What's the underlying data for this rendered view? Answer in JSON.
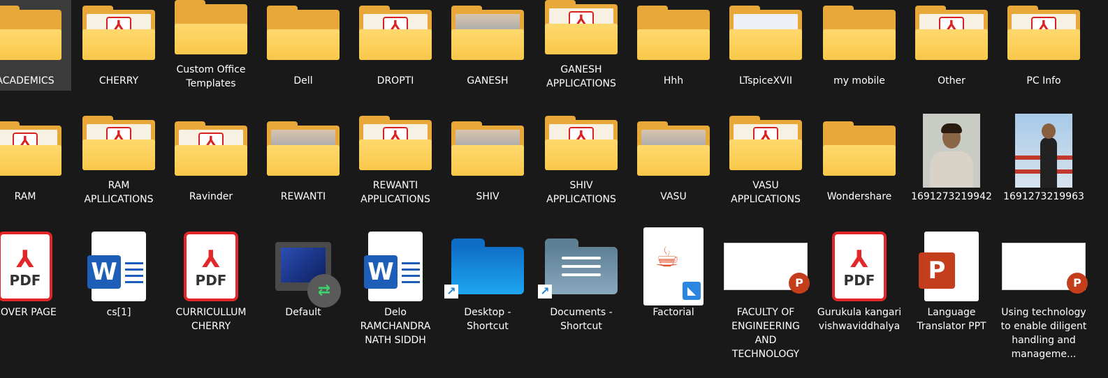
{
  "rows": [
    [
      {
        "label": "ACADEMICS",
        "icon": "folder-icon",
        "selected": true
      },
      {
        "label": "CHERRY",
        "icon": "folder-pdf-icon"
      },
      {
        "label": "Custom Office Templates",
        "icon": "folder-icon"
      },
      {
        "label": "Dell",
        "icon": "folder-icon"
      },
      {
        "label": "DROPTI",
        "icon": "folder-pdf-icon"
      },
      {
        "label": "GANESH",
        "icon": "folder-photo-icon"
      },
      {
        "label": "GANESH APPLICATIONS",
        "icon": "folder-pdf-icon"
      },
      {
        "label": "Hhh",
        "icon": "folder-icon"
      },
      {
        "label": "LTspiceXVII",
        "icon": "folder-circuit-icon"
      },
      {
        "label": "my mobile",
        "icon": "folder-icon"
      },
      {
        "label": "Other",
        "icon": "folder-pdf-icon"
      },
      {
        "label": "PC Info",
        "icon": "folder-pdf-icon"
      }
    ],
    [
      {
        "label": "RAM",
        "icon": "folder-pdf-icon"
      },
      {
        "label": "RAM APLLICATIONS",
        "icon": "folder-pdf-icon"
      },
      {
        "label": "Ravinder",
        "icon": "folder-pdf-icon"
      },
      {
        "label": "REWANTI",
        "icon": "folder-photo-icon"
      },
      {
        "label": "REWANTI APPLICATIONS",
        "icon": "folder-pdf-icon"
      },
      {
        "label": "SHIV",
        "icon": "folder-photo-icon"
      },
      {
        "label": "SHIV APPLICATIONS",
        "icon": "folder-pdf-icon"
      },
      {
        "label": "VASU",
        "icon": "folder-photo-icon"
      },
      {
        "label": "VASU APPLICATIONS",
        "icon": "folder-pdf-icon"
      },
      {
        "label": "Wondershare",
        "icon": "folder-icon"
      },
      {
        "label": "1691273219942",
        "icon": "photo-portrait-icon"
      },
      {
        "label": "1691273219963",
        "icon": "photo-outdoor-icon"
      }
    ],
    [
      {
        "label": "COVER PAGE",
        "icon": "pdf-file-icon"
      },
      {
        "label": "cs[1]",
        "icon": "word-file-icon"
      },
      {
        "label": "CURRICULLUM CHERRY",
        "icon": "pdf-file-icon"
      },
      {
        "label": "Default",
        "icon": "remote-desktop-icon"
      },
      {
        "label": "Delo RAMCHANDRA NATH SIDDH",
        "icon": "word-file-icon"
      },
      {
        "label": "Desktop - Shortcut",
        "icon": "desktop-folder-shortcut-icon"
      },
      {
        "label": "Documents - Shortcut",
        "icon": "documents-folder-shortcut-icon"
      },
      {
        "label": "Factorial",
        "icon": "java-file-icon"
      },
      {
        "label": "FACULTY OF ENGINEERING AND TECHNOLOGY",
        "icon": "ppt-slide-thumbnail-icon"
      },
      {
        "label": "Gurukula kangari vishwaviddhalya",
        "icon": "pdf-file-icon"
      },
      {
        "label": "Language Translator PPT",
        "icon": "powerpoint-file-icon"
      },
      {
        "label": "Using technology to enable diligent handling and manageme...",
        "icon": "ppt-slide-thumbnail-icon"
      }
    ]
  ],
  "glyphs": {
    "pdf": "PDF",
    "word": "W",
    "ppt": "P",
    "acrobat": "⅄",
    "shortcut_arrow": "↗",
    "remote": "⇄",
    "java": "☕",
    "vscode": "◣"
  },
  "colors": {
    "background": "#191919",
    "folder": "#f8c849",
    "pdf_red": "#e12727",
    "word_blue": "#1d5fb8",
    "ppt_orange": "#c43e1c"
  }
}
